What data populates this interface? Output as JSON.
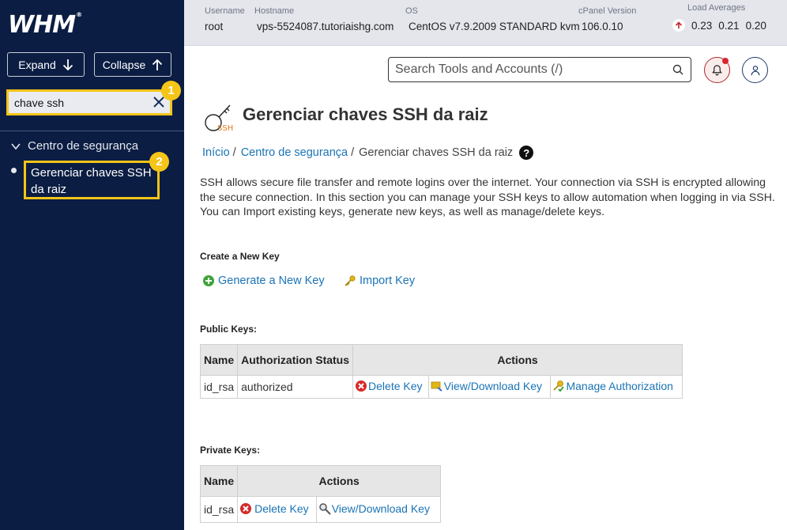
{
  "sidebar": {
    "logo": "WHM",
    "expand_label": "Expand",
    "collapse_label": "Collapse",
    "search_value": "chave ssh",
    "badge1": "1",
    "badge2": "2",
    "category": "Centro de segurança",
    "item": "Gerenciar chaves SSH da raiz"
  },
  "topbar": {
    "username_label": "Username",
    "username": "root",
    "hostname_label": "Hostname",
    "hostname": "vps-5524087.tutoriaishg.com",
    "os_label": "OS",
    "os": "CentOS v7.9.2009 STANDARD kvm",
    "cpanel_label": "cPanel Version",
    "cpanel": "106.0.10",
    "load_label": "Load Averages",
    "load": [
      "0.23",
      "0.21",
      "0.20"
    ]
  },
  "header": {
    "search_placeholder": "Search Tools and Accounts (/)"
  },
  "content": {
    "ssh_logo_text": "SSH",
    "title": "Gerenciar chaves SSH da raiz",
    "breadcrumb": [
      "Início",
      "Centro de segurança",
      "Gerenciar chaves SSH da raiz"
    ],
    "breadcrumb_sep": "/",
    "help": "?",
    "intro": "SSH allows secure file transfer and remote logins over the internet. Your connection via SSH is encrypted allowing the secure connection. In this section you can manage your SSH keys to allow automation when logging in via SSH. You can Import existing keys, generate new keys, as well as manage/delete keys.",
    "create_heading": "Create a New Key",
    "generate_label": "Generate a New Key",
    "import_label": "Import Key",
    "public_heading": "Public Keys:",
    "public_table": {
      "headers": [
        "Name",
        "Authorization Status",
        "Actions"
      ],
      "rows": [
        {
          "name": "id_rsa",
          "status": "authorized",
          "delete": "Delete Key",
          "view": "View/Download Key",
          "manage": "Manage Authorization"
        }
      ]
    },
    "private_heading": "Private Keys:",
    "private_table": {
      "headers": [
        "Name",
        "Actions"
      ],
      "rows": [
        {
          "name": "id_rsa",
          "delete": "Delete Key",
          "view": "View/Download Key"
        }
      ]
    }
  },
  "colors": {
    "sidebar_bg": "#0b1d43",
    "highlight": "#f5c518",
    "link": "#1a73b5",
    "topbar_bg": "#e4e6ec"
  }
}
